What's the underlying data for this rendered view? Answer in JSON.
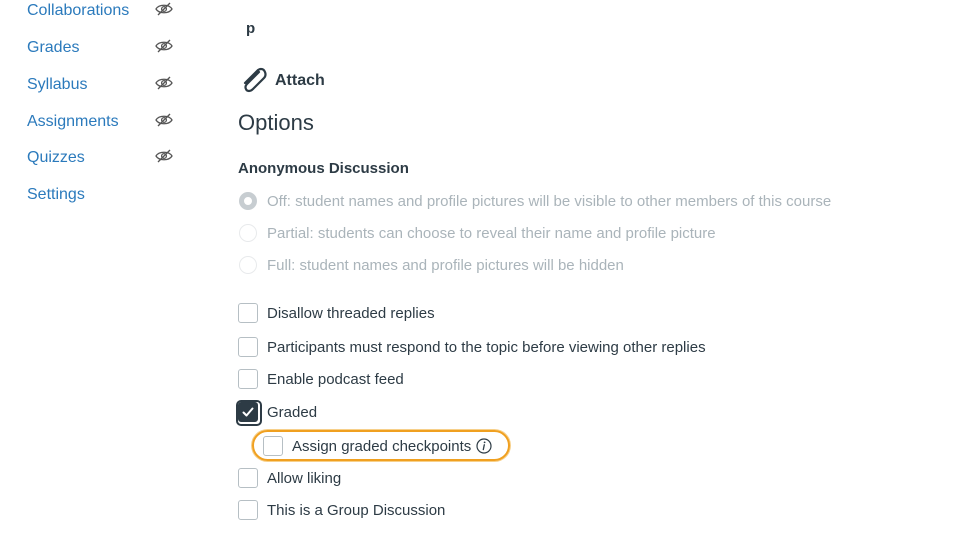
{
  "sidebar": {
    "items": [
      {
        "label": "Collaborations",
        "hidden_icon": "eye-slash-icon"
      },
      {
        "label": "Grades",
        "hidden_icon": "eye-slash-icon"
      },
      {
        "label": "Syllabus",
        "hidden_icon": "eye-slash-icon"
      },
      {
        "label": "Assignments",
        "hidden_icon": "eye-slash-icon"
      },
      {
        "label": "Quizzes",
        "hidden_icon": "eye-slash-icon"
      },
      {
        "label": "Settings"
      }
    ]
  },
  "editor": {
    "content": "p"
  },
  "attach": {
    "label": "Attach",
    "icon": "paperclip-icon"
  },
  "options": {
    "heading": "Options",
    "anonymous": {
      "heading": "Anonymous Discussion",
      "choices": [
        {
          "label": "Off: student names and profile pictures will be visible to other members of this course",
          "selected": true
        },
        {
          "label": "Partial: students can choose to reveal their name and profile picture",
          "selected": false
        },
        {
          "label": "Full: student names and profile pictures will be hidden",
          "selected": false
        }
      ]
    },
    "checkboxes": {
      "disallow_threaded": {
        "label": "Disallow threaded replies",
        "checked": false
      },
      "must_respond": {
        "label": "Participants must respond to the topic before viewing other replies",
        "checked": false
      },
      "podcast": {
        "label": "Enable podcast feed",
        "checked": false
      },
      "graded": {
        "label": "Graded",
        "checked": true
      },
      "checkpoints": {
        "label": "Assign graded checkpoints",
        "checked": false,
        "icon": "info-icon"
      },
      "allow_liking": {
        "label": "Allow liking",
        "checked": false
      },
      "group": {
        "label": "This is a Group Discussion",
        "checked": false
      }
    }
  },
  "colors": {
    "link": "#2b7abc",
    "text": "#2d3b45",
    "disabled": "#aab4ba",
    "highlight": "#f0a020"
  }
}
